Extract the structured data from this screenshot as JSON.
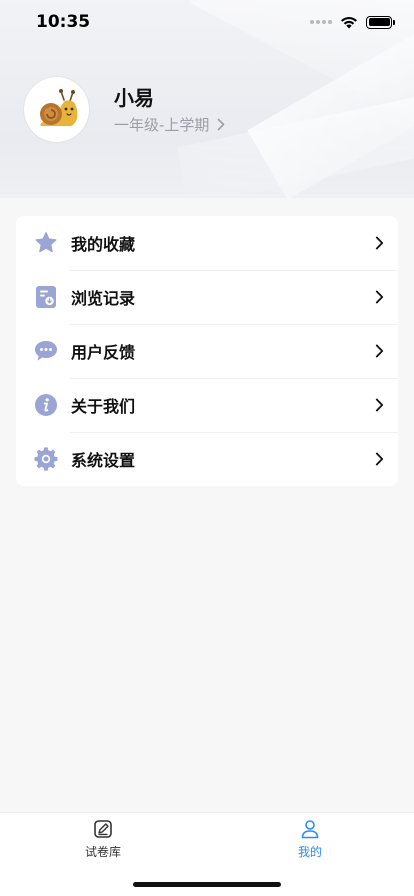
{
  "status_bar": {
    "time": "10:35"
  },
  "profile": {
    "name": "小易",
    "grade": "一年级-上学期"
  },
  "menu": {
    "items": [
      {
        "label": "我的收藏",
        "icon": "star-icon"
      },
      {
        "label": "浏览记录",
        "icon": "history-doc-icon"
      },
      {
        "label": "用户反馈",
        "icon": "chat-bubble-icon"
      },
      {
        "label": "关于我们",
        "icon": "info-icon"
      },
      {
        "label": "系统设置",
        "icon": "gear-icon"
      }
    ]
  },
  "tab_bar": {
    "tabs": [
      {
        "label": "试卷库",
        "icon": "edit-paper-icon",
        "active": false
      },
      {
        "label": "我的",
        "icon": "user-icon",
        "active": true
      }
    ]
  },
  "colors": {
    "accent": "#2a8cf7",
    "menu_icon": "#9aa5d6",
    "secondary_text": "#9a9ea6"
  }
}
